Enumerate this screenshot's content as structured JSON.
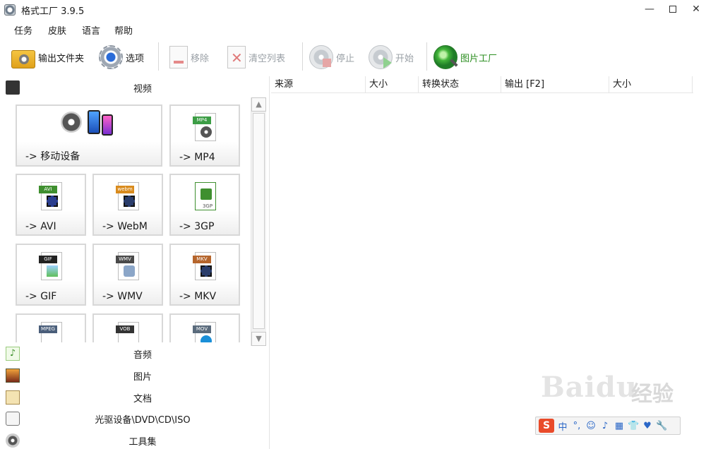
{
  "window": {
    "title": "格式工厂 3.9.5"
  },
  "menu": {
    "items": [
      "任务",
      "皮肤",
      "语言",
      "帮助"
    ]
  },
  "toolbar": {
    "output_folder": "输出文件夹",
    "options": "选项",
    "remove": "移除",
    "clear_list": "清空列表",
    "stop": "停止",
    "start": "开始",
    "picture_factory": "图片工厂"
  },
  "left": {
    "video_header": "视频",
    "tiles": [
      {
        "label": "-> 移动设备"
      },
      {
        "label": "-> MP4",
        "tag": "MP4"
      },
      {
        "label": "-> AVI",
        "tag": "AVI"
      },
      {
        "label": "-> WebM",
        "tag": "webm"
      },
      {
        "label": "-> 3GP",
        "tag": "3GP"
      },
      {
        "label": "-> GIF",
        "tag": "GIF"
      },
      {
        "label": "-> WMV",
        "tag": "WMV"
      },
      {
        "label": "-> MKV",
        "tag": "MKV"
      },
      {
        "tag": "MPEG"
      },
      {
        "tag": "VOB"
      },
      {
        "tag": "MOV"
      }
    ],
    "categories": [
      "音频",
      "图片",
      "文档",
      "光驱设备\\DVD\\CD\\ISO",
      "工具集"
    ]
  },
  "table": {
    "columns": [
      "来源",
      "大小",
      "转换状态",
      "输出 [F2]",
      "大小"
    ]
  },
  "watermark": {
    "brand": "Baidu",
    "text": "经验"
  },
  "tray": {
    "s": "S",
    "items": [
      "中",
      "°,",
      "☺",
      "♪",
      "▦",
      "👕",
      "♥",
      "🔧"
    ]
  },
  "colors": {
    "accent_green": "#2d8f22",
    "disabled": "#9aa0a6",
    "tile_border": "#d8d8d8"
  }
}
